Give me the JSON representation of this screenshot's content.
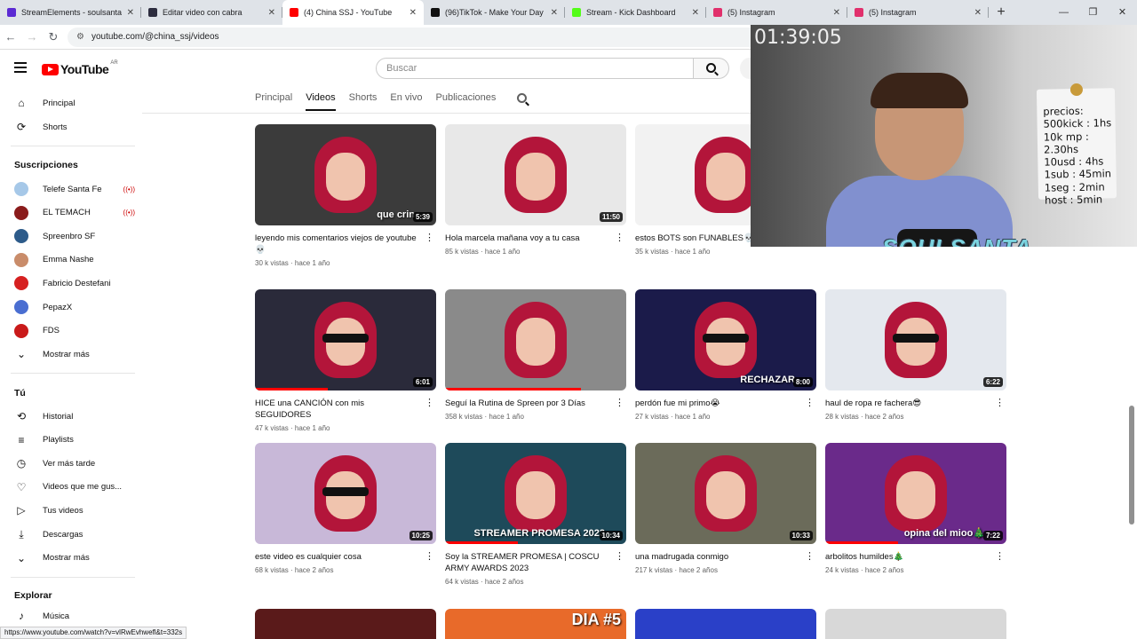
{
  "browser": {
    "tabs": [
      {
        "title": "StreamElements - soulsanta",
        "favicon_color": "#5b2ad3",
        "active": false
      },
      {
        "title": "Editar video con cabra",
        "favicon_color": "#2d2d3f",
        "active": false
      },
      {
        "title": "(4) China SSJ - YouTube",
        "favicon_color": "#ff0000",
        "active": true
      },
      {
        "title": "(96)TikTok - Make Your Day",
        "favicon_color": "#111111",
        "active": false
      },
      {
        "title": "Stream - Kick Dashboard",
        "favicon_color": "#53fc18",
        "active": false
      },
      {
        "title": "(5) Instagram",
        "favicon_color": "#e1306c",
        "active": false
      },
      {
        "title": "(5) Instagram",
        "favicon_color": "#e1306c",
        "active": false
      }
    ],
    "url": "youtube.com/@china_ssj/videos",
    "status_url": "https://www.youtube.com/watch?v=vlRwEvhwefl&t=332s"
  },
  "masthead": {
    "logo_text": "YouTube",
    "country_code": "AR",
    "search_placeholder": "Buscar"
  },
  "sidebar": {
    "main": [
      {
        "label": "Principal",
        "icon": "home-icon"
      },
      {
        "label": "Shorts",
        "icon": "shorts-icon"
      }
    ],
    "subscriptions_header": "Suscripciones",
    "subscriptions": [
      {
        "label": "Telefe Santa Fe",
        "color": "#a6c8e8",
        "live": true
      },
      {
        "label": "EL TEMACH",
        "color": "#8a1b1b",
        "live": true
      },
      {
        "label": "Spreenbro SF",
        "color": "#2d5b8a",
        "live": false
      },
      {
        "label": "Emma Nashe",
        "color": "#c98c6a",
        "live": false
      },
      {
        "label": "Fabricio Destefani",
        "color": "#d62020",
        "live": false
      },
      {
        "label": "PepazX",
        "color": "#4a6ed1",
        "live": false
      },
      {
        "label": "FDS",
        "color": "#c91a1a",
        "live": false
      }
    ],
    "show_more": "Mostrar más",
    "you_header": "Tú",
    "you_items": [
      {
        "label": "Historial",
        "icon": "history-icon"
      },
      {
        "label": "Playlists",
        "icon": "playlists-icon"
      },
      {
        "label": "Ver más tarde",
        "icon": "watch-later-icon"
      },
      {
        "label": "Videos que me gus...",
        "icon": "like-icon"
      },
      {
        "label": "Tus videos",
        "icon": "your-videos-icon"
      },
      {
        "label": "Descargas",
        "icon": "download-icon"
      },
      {
        "label": "Mostrar más",
        "icon": "chevron-down-icon"
      }
    ],
    "explore_header": "Explorar",
    "explore_items": [
      {
        "label": "Música",
        "icon": "music-icon"
      }
    ],
    "live_badge": "((•))"
  },
  "channel_tabs": [
    "Principal",
    "Videos",
    "Shorts",
    "En vivo",
    "Publicaciones"
  ],
  "selected_tab": "Videos",
  "videos": [
    {
      "title": "leyendo mis comentarios viejos de youtube 💀",
      "meta": "30 k vistas · hace 1 año",
      "duration": "5:39",
      "overlay": "que crin",
      "color": "#3b3b3b"
    },
    {
      "title": "Hola marcela mañana voy a tu casa",
      "meta": "85 k vistas · hace 1 año",
      "duration": "11:50",
      "overlay": "",
      "color": "#e8e8e8"
    },
    {
      "title": "estos BOTS son FUNABLES💀",
      "meta": "35 k vistas · hace 1 año",
      "duration": "",
      "overlay": "",
      "color": "#f2f2f2"
    },
    {
      "title": "",
      "meta": "52 k vistas · hace",
      "duration": "",
      "overlay": "",
      "color": "#ffffff"
    },
    {
      "title": "HICE una CANCIÓN con mis SEGUIDORES",
      "meta": "47 k vistas · hace 1 año",
      "duration": "6:01",
      "overlay": "",
      "color": "#2a2a3a"
    },
    {
      "title": "Seguí la Rutina de Spreen por 3 Días",
      "meta": "358 k vistas · hace 1 año",
      "duration": "",
      "overlay": "",
      "color": "#8a8a8a"
    },
    {
      "title": "perdón fue mi primo😭",
      "meta": "27 k vistas · hace 1 año",
      "duration": "8:00",
      "overlay": "RECHAZAR",
      "color": "#1b1b4a"
    },
    {
      "title": "haul de ropa re fachera😎",
      "meta": "28 k vistas · hace 2 años",
      "duration": "6:22",
      "overlay": "",
      "color": "#e4e8ee"
    },
    {
      "title": "este video es cualquier cosa",
      "meta": "68 k vistas · hace 2 años",
      "duration": "10:25",
      "overlay": "",
      "color": "#c8b8d8"
    },
    {
      "title": "Soy la STREAMER PROMESA | COSCU ARMY AWARDS 2023",
      "meta": "64 k vistas · hace 2 años",
      "duration": "10:34",
      "overlay": "STREAMER PROMESA 2023",
      "color": "#1e4a5a"
    },
    {
      "title": "una madrugada conmigo",
      "meta": "217 k vistas · hace 2 años",
      "duration": "10:33",
      "overlay": "",
      "color": "#6b6b5a"
    },
    {
      "title": "arbolitos humildes🎄",
      "meta": "24 k vistas · hace 2 años",
      "duration": "7:22",
      "overlay": "opina del mioo🎄",
      "color": "#6a2a8a"
    }
  ],
  "next_row_overlay": "DIA #5",
  "stream_overlay": {
    "timer": "01:39:05",
    "note_lines": [
      "precios:",
      "500kick : 1hs",
      "10k mp : 2.30hs",
      "10usd : 4hs",
      "1sub : 45min",
      "1seg : 2min",
      "host : 5min"
    ],
    "brand": "SOULSANTA"
  }
}
